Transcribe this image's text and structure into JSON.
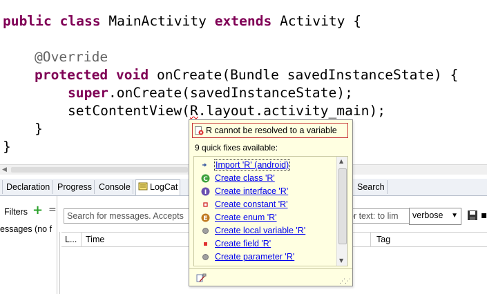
{
  "editor": {
    "code": {
      "l1_public": "public",
      "l1_class": "class",
      "l1_name": "MainActivity",
      "l1_extends": "extends",
      "l1_super": "Activity {",
      "l3_annotation": "@Override",
      "l4_protected": "protected",
      "l4_void": "void",
      "l4_sig": "onCreate(Bundle savedInstanceState) {",
      "l5_super": "super",
      "l5_call": ".onCreate(savedInstanceState);",
      "l6_pre": "setContentView(",
      "l6_err": "R",
      "l6_post": ".layout.activity_main);",
      "l7": "}",
      "l8": "}"
    }
  },
  "views": {
    "tabs": [
      "Declaration",
      "Progress",
      "Console",
      "LogCat",
      "Search"
    ]
  },
  "logcat": {
    "filters_label": "Filters",
    "filters_add": "+",
    "filters_remove": "=",
    "filters_list_header": "essages (no f",
    "search_placeholder": "Search for messages. Accepts",
    "search2_placeholder": "or text: to lim",
    "level_value": "verbose",
    "columns": {
      "level": "L...",
      "time": "Time",
      "tag": "Tag"
    }
  },
  "quickfix": {
    "title": "R cannot be resolved to a variable",
    "count_text": "9 quick fixes available:",
    "items": [
      {
        "label": "Import 'R' (android)",
        "icon": "import-icon"
      },
      {
        "label": "Create class 'R'",
        "icon": "class-icon"
      },
      {
        "label": "Create interface 'R'",
        "icon": "interface-icon"
      },
      {
        "label": "Create constant 'R'",
        "icon": "constant-icon"
      },
      {
        "label": "Create enum 'R'",
        "icon": "enum-icon"
      },
      {
        "label": "Create local variable 'R'",
        "icon": "local-variable-icon"
      },
      {
        "label": "Create field 'R'",
        "icon": "field-icon"
      },
      {
        "label": "Create parameter 'R'",
        "icon": "parameter-icon"
      }
    ]
  }
}
